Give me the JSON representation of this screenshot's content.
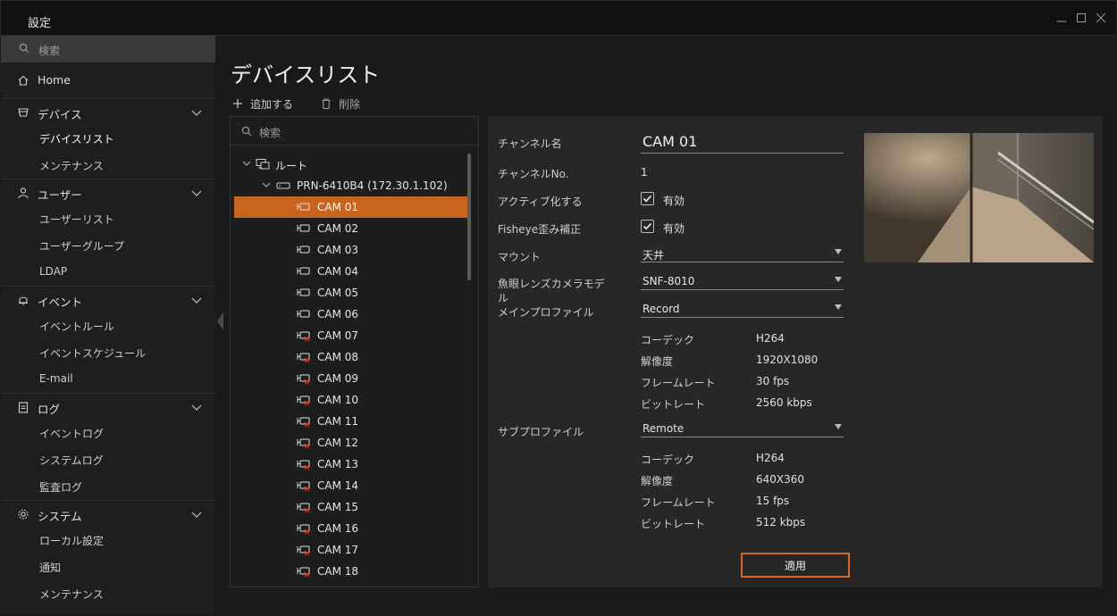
{
  "window": {
    "title": "設定"
  },
  "sidebar": {
    "search_placeholder": "検索",
    "sections": [
      {
        "label": "Home",
        "icon": "home-icon"
      },
      {
        "label": "デバイス",
        "icon": "device-icon",
        "items": [
          "デバイスリスト",
          "メンテナンス"
        ]
      },
      {
        "label": "ユーザー",
        "icon": "user-icon",
        "items": [
          "ユーザーリスト",
          "ユーザーグループ",
          "LDAP"
        ]
      },
      {
        "label": "イベント",
        "icon": "bell-icon",
        "items": [
          "イベントルール",
          "イベントスケジュール",
          "E-mail"
        ]
      },
      {
        "label": "ログ",
        "icon": "clipboard-icon",
        "items": [
          "イベントログ",
          "システムログ",
          "監査ログ"
        ]
      },
      {
        "label": "システム",
        "icon": "gear-icon",
        "items": [
          "ローカル設定",
          "通知",
          "メンテナンス"
        ]
      }
    ],
    "active_item": "デバイスリスト"
  },
  "main": {
    "title": "デバイスリスト",
    "toolbar": {
      "add_label": "追加する",
      "delete_label": "削除"
    },
    "tree": {
      "search_placeholder": "検索",
      "root_label": "ルート",
      "recorder_label": "PRN-6410B4 (172.30.1.102)",
      "cameras": [
        {
          "label": "CAM 01",
          "connected": true
        },
        {
          "label": "CAM 02",
          "connected": true
        },
        {
          "label": "CAM 03",
          "connected": true
        },
        {
          "label": "CAM 04",
          "connected": true
        },
        {
          "label": "CAM 05",
          "connected": true
        },
        {
          "label": "CAM 06",
          "connected": true
        },
        {
          "label": "CAM 07",
          "connected": false
        },
        {
          "label": "CAM 08",
          "connected": false
        },
        {
          "label": "CAM 09",
          "connected": false
        },
        {
          "label": "CAM 10",
          "connected": false
        },
        {
          "label": "CAM 11",
          "connected": false
        },
        {
          "label": "CAM 12",
          "connected": false
        },
        {
          "label": "CAM 13",
          "connected": false
        },
        {
          "label": "CAM 14",
          "connected": false
        },
        {
          "label": "CAM 15",
          "connected": false
        },
        {
          "label": "CAM 16",
          "connected": false
        },
        {
          "label": "CAM 17",
          "connected": false
        },
        {
          "label": "CAM 18",
          "connected": false
        }
      ],
      "selected": "CAM 01"
    },
    "details": {
      "channel_name_label": "チャンネル名",
      "channel_name_value": "CAM 01",
      "channel_no_label": "チャンネルNo.",
      "channel_no_value": "1",
      "activate_label": "アクティブ化する",
      "activate_value": "有効",
      "fisheye_label": "Fisheye歪み補正",
      "fisheye_value": "有効",
      "mount_label": "マウント",
      "mount_value": "天井",
      "fisheye_model_label_line1": "魚眼レンズカメラモデ",
      "fisheye_model_label_line2": "ル",
      "fisheye_model_value": "SNF-8010",
      "main_profile_label": "メインプロファイル",
      "main_profile_value": "Record",
      "main_profile_info": [
        {
          "label": "コーデック",
          "value": "H264"
        },
        {
          "label": "解像度",
          "value": "1920X1080"
        },
        {
          "label": "フレームレート",
          "value": "30 fps"
        },
        {
          "label": "ビットレート",
          "value": "2560 kbps"
        }
      ],
      "sub_profile_label": "サブプロファイル",
      "sub_profile_value": "Remote",
      "sub_profile_info": [
        {
          "label": "コーデック",
          "value": "H264"
        },
        {
          "label": "解像度",
          "value": "640X360"
        },
        {
          "label": "フレームレート",
          "value": "15 fps"
        },
        {
          "label": "ビットレート",
          "value": "512 kbps"
        }
      ],
      "apply_label": "適用"
    }
  },
  "colors": {
    "accent": "#c8641e",
    "apply_border": "#d66a1c",
    "disconnected": "#d03030"
  }
}
